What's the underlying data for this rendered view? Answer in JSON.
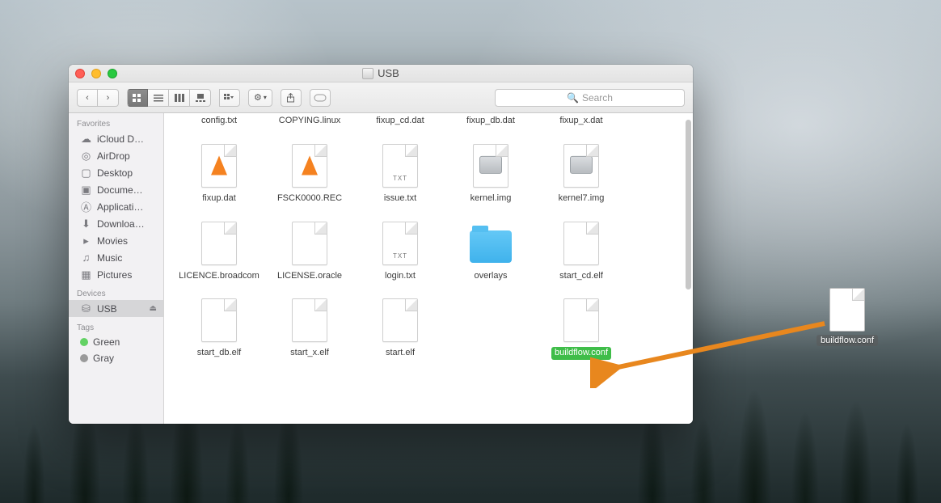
{
  "window": {
    "title": "USB"
  },
  "toolbar": {
    "back_label": "‹",
    "fwd_label": "›",
    "view_icon": "icon-view",
    "view_list": "list-view",
    "view_col": "column-view",
    "view_cover": "cover-view",
    "arrange_label": "≣",
    "gear_label": "⚙",
    "share_label": "↑",
    "tags_label": "⌂"
  },
  "search": {
    "placeholder": "Search"
  },
  "sidebar": {
    "sections": [
      {
        "title": "Favorites",
        "items": [
          {
            "icon": "cloud",
            "label": "iCloud D…"
          },
          {
            "icon": "airdrop",
            "label": "AirDrop"
          },
          {
            "icon": "desktop",
            "label": "Desktop"
          },
          {
            "icon": "folder",
            "label": "Docume…"
          },
          {
            "icon": "app",
            "label": "Applicati…"
          },
          {
            "icon": "download",
            "label": "Downloa…"
          },
          {
            "icon": "movies",
            "label": "Movies"
          },
          {
            "icon": "music",
            "label": "Music"
          },
          {
            "icon": "pictures",
            "label": "Pictures"
          }
        ]
      },
      {
        "title": "Devices",
        "items": [
          {
            "icon": "disk",
            "label": "USB",
            "selected": true,
            "eject": true
          }
        ]
      },
      {
        "title": "Tags",
        "items": [
          {
            "tag": "#63d264",
            "label": "Green"
          },
          {
            "tag": "#9a9a9a",
            "label": "Gray"
          }
        ]
      }
    ]
  },
  "files": [
    {
      "name": "config.txt",
      "kind": "label"
    },
    {
      "name": "COPYING.linux",
      "kind": "label"
    },
    {
      "name": "fixup_cd.dat",
      "kind": "label"
    },
    {
      "name": "fixup_db.dat",
      "kind": "label"
    },
    {
      "name": "fixup_x.dat",
      "kind": "label"
    },
    {
      "name": "fixup.dat",
      "kind": "vlc"
    },
    {
      "name": "FSCK0000.REC",
      "kind": "vlc"
    },
    {
      "name": "issue.txt",
      "kind": "txt"
    },
    {
      "name": "kernel.img",
      "kind": "img"
    },
    {
      "name": "kernel7.img",
      "kind": "img"
    },
    {
      "name": "LICENCE.broadcom",
      "kind": "blank"
    },
    {
      "name": "LICENSE.oracle",
      "kind": "blank"
    },
    {
      "name": "login.txt",
      "kind": "txt"
    },
    {
      "name": "overlays",
      "kind": "folder"
    },
    {
      "name": "start_cd.elf",
      "kind": "blank"
    },
    {
      "name": "start_db.elf",
      "kind": "blank"
    },
    {
      "name": "start_x.elf",
      "kind": "blank"
    },
    {
      "name": "start.elf",
      "kind": "blank"
    },
    {
      "name": "",
      "kind": "gap"
    },
    {
      "name": "buildflow.conf",
      "kind": "blank",
      "selected": true
    }
  ],
  "desktop_file": {
    "name": "buildflow.conf"
  },
  "tags_txt": "TXT",
  "sb_icons": {
    "cloud": "☁",
    "airdrop": "◎",
    "desktop": "▢",
    "folder": "▣",
    "app": "Ⓐ",
    "download": "⬇",
    "movies": "▸",
    "music": "♫",
    "pictures": "▦",
    "disk": "⛁"
  }
}
